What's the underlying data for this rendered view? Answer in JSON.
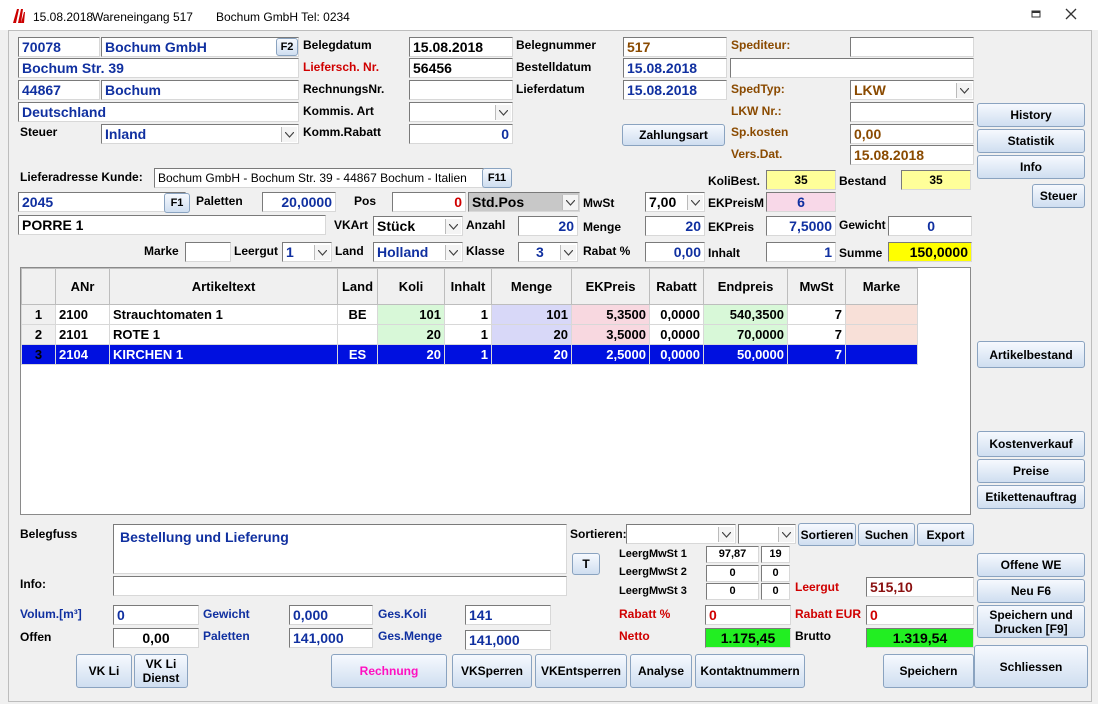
{
  "title": {
    "date": "15.08.2018",
    "doc": "Wareneingang 517",
    "company": "Bochum GmbH  Tel: 0234"
  },
  "colors": {
    "green": "#22ee22",
    "yellow": "#ffff99",
    "pink": "#f8d8e8",
    "selected": "#0010e0"
  },
  "header": {
    "kd_nr": "70078",
    "name": "Bochum GmbH",
    "f2": "F2",
    "street": "Bochum Str. 39",
    "plz": "44867",
    "city": "Bochum",
    "country": "Deutschland",
    "steuer_label": "Steuer",
    "steuer": "Inland",
    "belegdatum_label": "Belegdatum",
    "belegdatum": "15.08.2018",
    "liefersch_label": "Liefersch. Nr.",
    "liefersch": "56456",
    "rechnungsnr_label": "RechnungsNr.",
    "rechnungsnr": "",
    "kommis_label": "Kommis. Art",
    "kommis": "",
    "kommrabatt_label": "Komm.Rabatt",
    "kommrabatt": "0",
    "belegnummer_label": "Belegnummer",
    "belegnummer": "517",
    "bestelldatum_label": "Bestelldatum",
    "bestelldatum": "15.08.2018",
    "lieferdatum_label": "Lieferdatum",
    "lieferdatum": "15.08.2018",
    "zahlungsart": "Zahlungsart",
    "spediteur_label": "Spediteur:",
    "spediteur": "",
    "spedtyp_label": "SpedTyp:",
    "spedtyp": "LKW",
    "lkwnr_label": "LKW Nr.:",
    "lkwnr": "",
    "spkosten_label": "Sp.kosten",
    "spkosten": "0,00",
    "versdat_label": "Vers.Dat.",
    "versdat": "15.08.2018"
  },
  "side": {
    "history": "History",
    "statistik": "Statistik",
    "info": "Info",
    "steuer": "Steuer",
    "artikelbestand": "Artikelbestand",
    "kostenverkauf": "Kostenverkauf",
    "preise": "Preise",
    "etiketten": "Etikettenauftrag",
    "offene": "Offene WE",
    "neu": "Neu F6",
    "speichern_drucken": "Speichern und Drucken [F9]",
    "schliessen": "Schliessen"
  },
  "entry": {
    "lieferadresse_label": "Lieferadresse Kunde:",
    "lieferadresse": "Bochum GmbH  - Bochum Str. 39 - 44867 Bochum - Italien",
    "f11": "F11",
    "kolibest_label": "KoliBest.",
    "kolibest": "35",
    "bestand_label": "Bestand",
    "bestand": "35",
    "artnr": "2045",
    "f1": "F1",
    "paletten_label": "Paletten",
    "paletten": "20,0000",
    "pos_label": "Pos",
    "pos": "0",
    "stdpos": "Std.Pos",
    "mwst_label": "MwSt",
    "mwst": "7,00",
    "ekpreism_label": "EKPreisM",
    "ekpreism": "6",
    "artname": "PORRE 1",
    "vkart_label": "VKArt",
    "vkart": "Stück",
    "anzahl_label": "Anzahl",
    "anzahl": "20",
    "menge_label": "Menge",
    "menge": "20",
    "ekpreis_label": "EKPreis",
    "ekpreis": "7,5000",
    "gewicht_label": "Gewicht",
    "gewicht": "0",
    "marke_label": "Marke",
    "marke": "",
    "leergut_label": "Leergut",
    "leergut": "1",
    "land_label": "Land",
    "land": "Holland",
    "klasse_label": "Klasse",
    "klasse": "3",
    "rabatt_label": "Rabat %",
    "rabatt": "0,00",
    "inhalt_label": "Inhalt",
    "inhalt": "1",
    "summe_label": "Summe",
    "summe": "150,0000"
  },
  "table": {
    "headers": [
      "",
      "ANr",
      "Artikeltext",
      "Land",
      "Koli",
      "Inhalt",
      "Menge",
      "EKPreis",
      "Rabatt",
      "Endpreis",
      "MwSt",
      "Marke"
    ],
    "rows": [
      [
        "1",
        "2100",
        "Strauchtomaten 1",
        "BE",
        "101",
        "1",
        "101",
        "5,3500",
        "0,0000",
        "540,3500",
        "7",
        ""
      ],
      [
        "2",
        "2101",
        "ROTE 1",
        "",
        "20",
        "1",
        "20",
        "3,5000",
        "0,0000",
        "70,0000",
        "7",
        ""
      ],
      [
        "3",
        "2104",
        "KIRCHEN 1",
        "ES",
        "20",
        "1",
        "20",
        "2,5000",
        "0,0000",
        "50,0000",
        "7",
        ""
      ]
    ]
  },
  "footer": {
    "belegfuss_label": "Belegfuss",
    "belegfuss": "Bestellung und Lieferung",
    "info_label": "Info:",
    "info": "",
    "sortieren_label": "Sortieren:",
    "sortieren_btn": "Sortieren",
    "suchen": "Suchen",
    "export": "Export",
    "t": "T",
    "leergmwst1_label": "LeergMwSt 1",
    "leergmwst1_a": "97,87",
    "leergmwst1_b": "19",
    "leergmwst2_label": "LeergMwSt 2",
    "leergmwst2_a": "0",
    "leergmwst2_b": "0",
    "leergmwst3_label": "LeergMwSt 3",
    "leergmwst3_a": "0",
    "leergmwst3_b": "0",
    "leergut_label": "Leergut",
    "leergut": "515,10",
    "volum_label": "Volum.[m³]",
    "volum": "0",
    "gewicht_label": "Gewicht",
    "gewicht": "0,000",
    "geskoli_label": "Ges.Koli",
    "geskoli": "141",
    "offen_label": "Offen",
    "offen": "0,00",
    "paletten_label": "Paletten",
    "paletten": "141,000",
    "gesmenge_label": "Ges.Menge",
    "gesmenge": "141,000",
    "rabattp_label": "Rabatt %",
    "rabattp": "0",
    "rabatteur_label": "Rabatt EUR",
    "rabatteur": "0",
    "netto_label": "Netto",
    "netto": "1.175,45",
    "brutto_label": "Brutto",
    "brutto": "1.319,54"
  },
  "bottom": {
    "vkli": "VK Li",
    "vklidienst": "VK  Li Dienst",
    "rechnung": "Rechnung",
    "vksperren": "VKSperren",
    "vkentsperren": "VKEntsperren",
    "analyse": "Analyse",
    "kontakt": "Kontaktnummern",
    "speichern": "Speichern"
  }
}
